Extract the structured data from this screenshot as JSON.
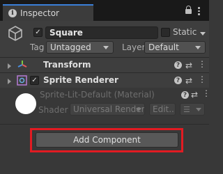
{
  "tab": {
    "title": "Inspector",
    "icons": [
      "info-icon",
      "lock-icon",
      "kebab-menu-icon"
    ]
  },
  "object": {
    "active": true,
    "name": "Square",
    "static_label": "Static",
    "static_checked": false,
    "tag_label": "Tag",
    "tag_value": "Untagged",
    "layer_label": "Layer",
    "layer_value": "Default"
  },
  "components": [
    {
      "title": "Transform",
      "icon": "transform-icon",
      "has_checkbox": false
    },
    {
      "title": "Sprite Renderer",
      "icon": "sprite-renderer-icon",
      "has_checkbox": true,
      "enabled": true
    }
  ],
  "material": {
    "name": "Sprite-Lit-Default (Material)",
    "shader_label": "Shader",
    "shader_value": "Universal Render I",
    "edit_label": "Edit...",
    "list_icon": "list-icon"
  },
  "footer": {
    "add_component_label": "Add Component"
  },
  "colors": {
    "accent": "#3a7fd8",
    "highlight": "#e11b22",
    "background": "#383838"
  }
}
